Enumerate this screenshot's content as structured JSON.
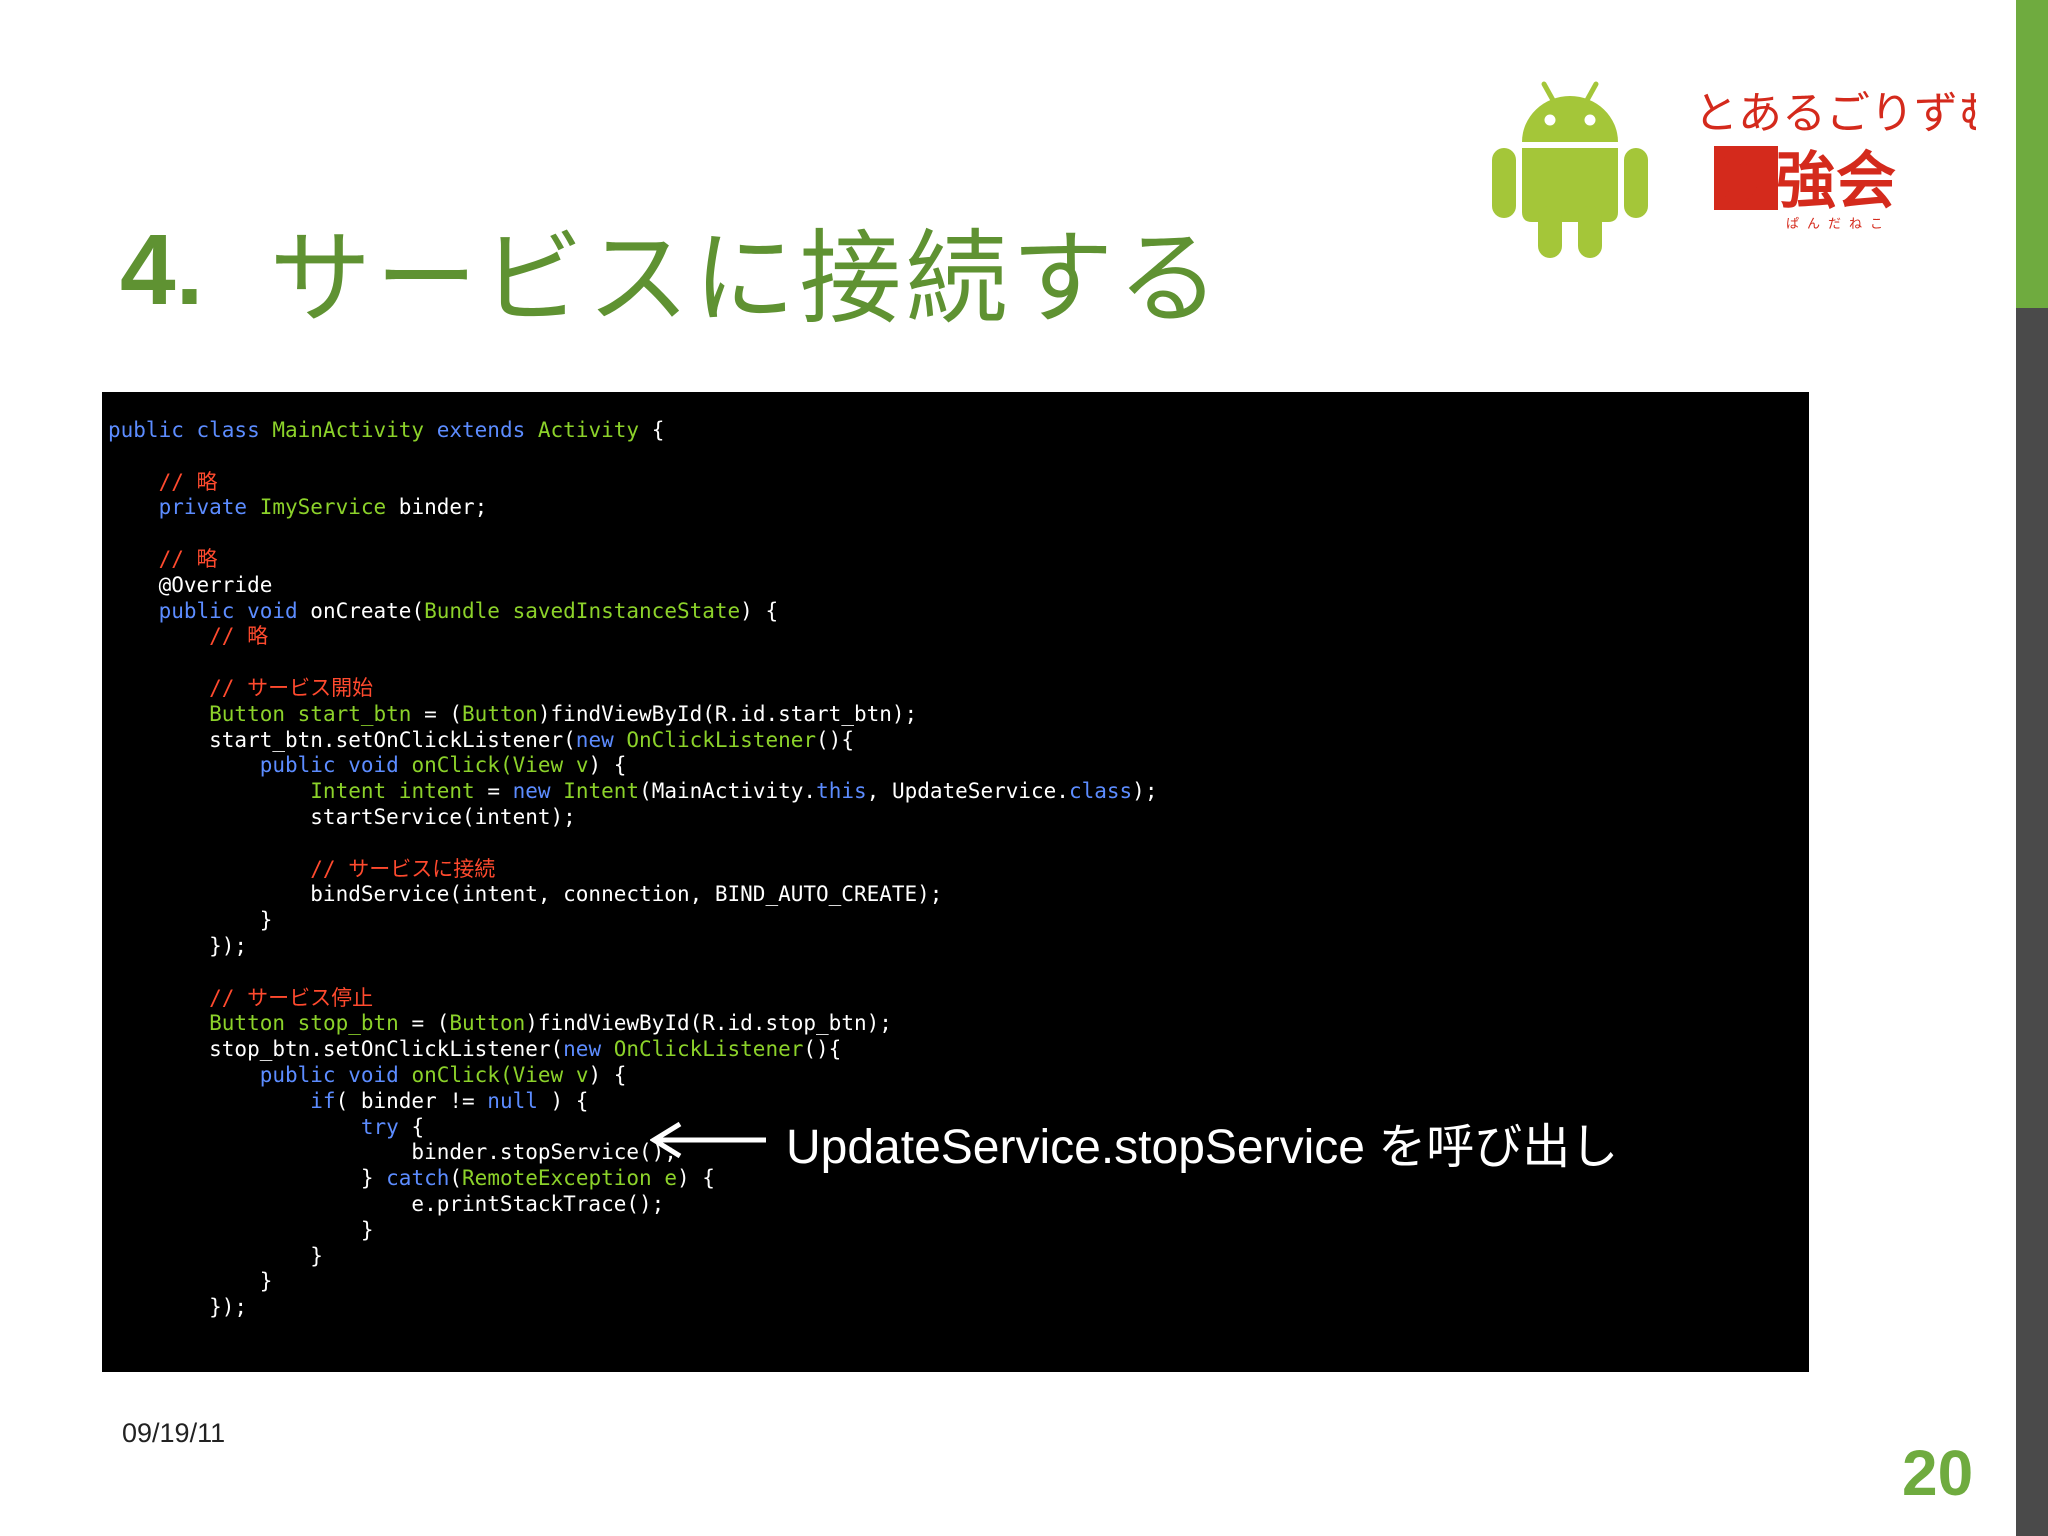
{
  "slide": {
    "title_number": "4.",
    "title_text": "サービスに接続する",
    "annotation": "UpdateService.stopService を呼び出し",
    "date": "09/19/11",
    "page_number": "20",
    "logo_text_line1": "とあるごりずむの",
    "logo_text_line2": "勉強会",
    "logo_text_small": "ぱんだねこ"
  },
  "code": {
    "l1_kw": "public class",
    "l1_name": " MainActivity ",
    "l1_kw2": "extends",
    "l1_type": " Activity",
    "l1_end": " {",
    "l3_comment": "    // 略",
    "l4_kw": "    private",
    "l4_type": " ImyService",
    "l4_rest": " binder;",
    "l6_comment": "    // 略",
    "l7": "    @Override",
    "l8_kw": "    public void",
    "l8_name": " onCreate(",
    "l8_type": "Bundle",
    "l8_param": " savedInstanceState",
    "l8_end": ") {",
    "l9_comment": "        // 略",
    "l11_comment": "        // サービス開始",
    "l12_type": "        Button",
    "l12_var": " start_btn",
    "l12_mid": " = (",
    "l12_type2": "Button",
    "l12_end": ")findViewById(R.id.start_btn);",
    "l13_a": "        start_btn.setOnClickListener(",
    "l13_kw": "new",
    "l13_type": " OnClickListener",
    "l13_end": "(){",
    "l14_kw": "            public void",
    "l14_name": " onClick(",
    "l14_type": "View",
    "l14_param": " v",
    "l14_end": ") {",
    "l15_type": "                Intent",
    "l15_var": " intent",
    "l15_mid": " = ",
    "l15_kw": "new",
    "l15_type2": " Intent",
    "l15_a": "(MainActivity.",
    "l15_kw2": "this",
    "l15_b": ", UpdateService.",
    "l15_kw3": "class",
    "l15_end": ");",
    "l16": "                startService(intent);",
    "l18_comment": "                // サービスに接続",
    "l19": "                bindService(intent, connection, BIND_AUTO_CREATE);",
    "l20": "            }",
    "l21": "        });",
    "l23_comment": "        // サービス停止",
    "l24_type": "        Button",
    "l24_var": " stop_btn",
    "l24_mid": " = (",
    "l24_type2": "Button",
    "l24_end": ")findViewById(R.id.stop_btn);",
    "l25_a": "        stop_btn.setOnClickListener(",
    "l25_kw": "new",
    "l25_type": " OnClickListener",
    "l25_end": "(){",
    "l26_kw": "            public void",
    "l26_name": " onClick(",
    "l26_type": "View",
    "l26_param": " v",
    "l26_end": ") {",
    "l27_kw": "                if",
    "l27_a": "( binder != ",
    "l27_kw2": "null",
    "l27_end": " ) {",
    "l28_kw": "                    try",
    "l28_end": " {",
    "l29": "                        binder.stopService();",
    "l30_a": "                    } ",
    "l30_kw": "catch",
    "l30_b": "(",
    "l30_type": "RemoteException",
    "l30_param": " e",
    "l30_end": ") {",
    "l31": "                        e.printStackTrace();",
    "l32": "                    }",
    "l33": "                }",
    "l34": "            }",
    "l35": "        });"
  },
  "colors": {
    "accent_green": "#6fab3f",
    "title_green": "#5f9232",
    "android_green": "#a4c639",
    "logo_red": "#d42a1c",
    "code_keyword": "#5c8cff",
    "code_type": "#8cd22a",
    "code_comment": "#ff4a2e"
  }
}
